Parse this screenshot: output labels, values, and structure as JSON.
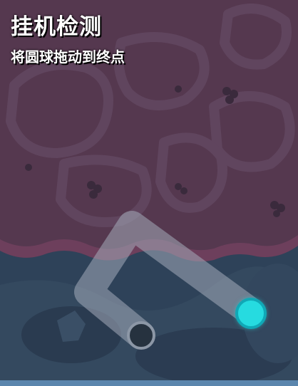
{
  "captcha": {
    "title": "挂机检测",
    "instruction": "将圆球拖动到终点",
    "drag_ball_color": "#26dbe0",
    "target_color": "#8c97a6",
    "track_color": "#a4acb9"
  }
}
